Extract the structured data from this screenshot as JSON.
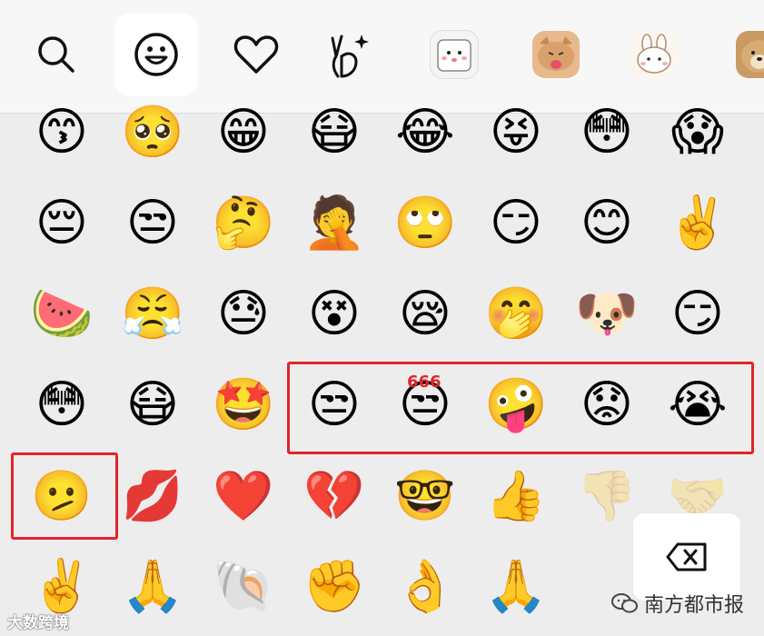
{
  "toolbar": {
    "tabs": [
      {
        "name": "search-tab",
        "icon": "search-icon"
      },
      {
        "name": "emoji-tab",
        "icon": "smiley-face-icon",
        "active": true
      },
      {
        "name": "favorites-tab",
        "icon": "heart-icon"
      },
      {
        "name": "gesture-tab",
        "icon": "victory-hand-sparkle-icon"
      },
      {
        "name": "sticker-pack-dog-tab",
        "icon": "white-dog-sticker-icon"
      },
      {
        "name": "sticker-pack-cat-tab",
        "icon": "cat-tongue-sticker-icon"
      },
      {
        "name": "sticker-pack-rabbit-tab",
        "icon": "rabbit-sticker-icon"
      },
      {
        "name": "sticker-pack-doge-tab",
        "icon": "doge-sticker-icon"
      }
    ]
  },
  "emoji_rows": [
    [
      "😙",
      "🥺",
      "😁",
      "😷",
      "😂",
      "😝",
      "😳",
      "😱"
    ],
    [
      "😔",
      "😒",
      "🤔",
      "🤦",
      "🙄",
      "😏",
      "😊",
      "✌️"
    ],
    [
      "🍉",
      "😤",
      "😓",
      "😵",
      "😪",
      "🤭",
      "🐶",
      "😏"
    ],
    [
      "😳",
      "😷",
      "🤩",
      "😒",
      "666",
      "🤪",
      "😟",
      "😭"
    ],
    [
      "🫤",
      "💋",
      "❤️",
      "💔",
      "🤓",
      "👍",
      "👎",
      "🤝"
    ],
    [
      "✌️",
      "🙏",
      "🐚",
      "✊",
      "👌",
      "🙏",
      "",
      ""
    ]
  ],
  "labels": {
    "badge_666": "666",
    "watermark_left": "大数跨境",
    "watermark_right": "南方都市报"
  },
  "colors": {
    "highlight": "#e0252b",
    "toolbar_bg": "#f7f7f7",
    "grid_bg": "#ededed"
  }
}
